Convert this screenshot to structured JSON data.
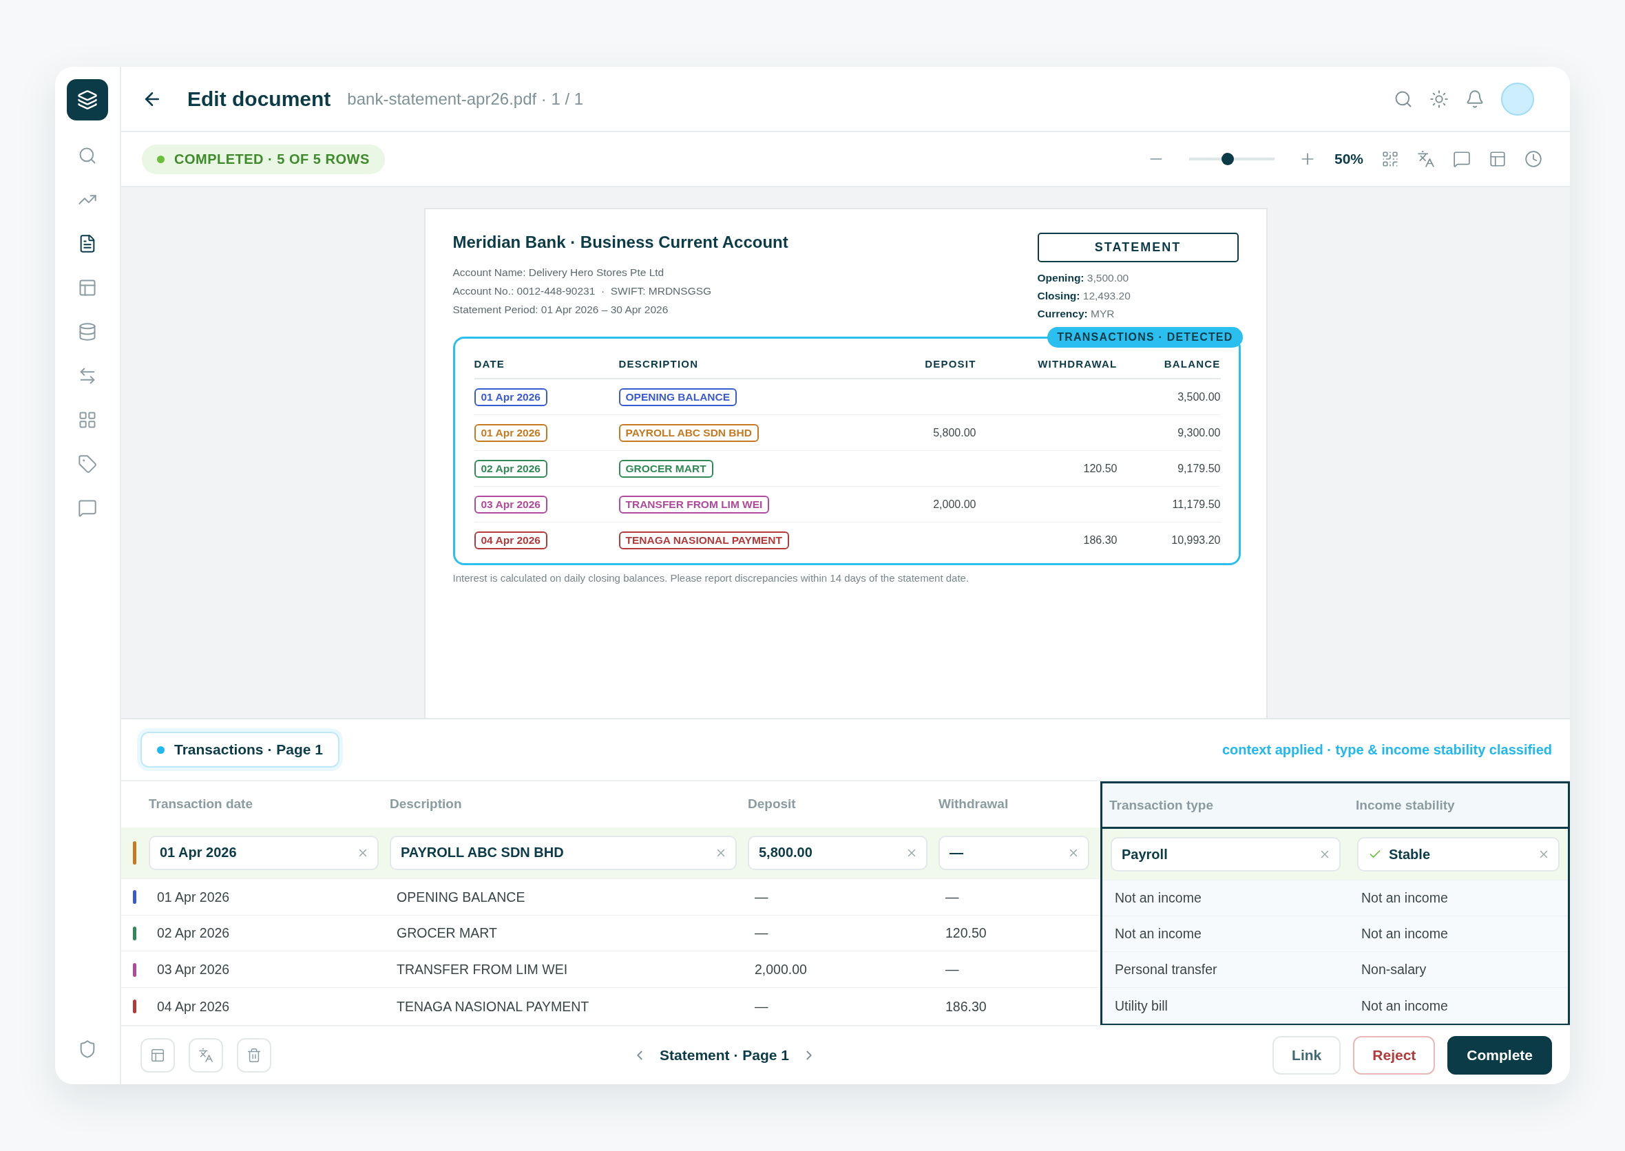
{
  "sidebar": {
    "items": [
      {
        "kind": "search",
        "selected": false
      },
      {
        "kind": "chart",
        "selected": false
      },
      {
        "kind": "document",
        "selected": true
      },
      {
        "kind": "layout",
        "selected": false
      },
      {
        "kind": "database",
        "selected": false
      },
      {
        "kind": "transfer",
        "selected": false
      },
      {
        "kind": "grid",
        "selected": false
      },
      {
        "kind": "tag",
        "selected": false
      },
      {
        "kind": "chat",
        "selected": false
      }
    ]
  },
  "header": {
    "title": "Edit document",
    "file": "bank-statement-apr26.pdf · 1 / 1"
  },
  "toolbar": {
    "status": "COMPLETED · 5 OF 5 ROWS",
    "zoom": {
      "level": 0.45,
      "reading": "50%"
    }
  },
  "document": {
    "title": "Meridian Bank · Business Current Account",
    "details": [
      "Account Name: Delivery Hero Stores Pte Ltd",
      "Account No.: 0012-448-90231  ·  SWIFT: MRDNSGSG",
      "Statement Period: 01 Apr 2026 – 30 Apr 2026"
    ],
    "label": "STATEMENT",
    "summary": [
      {
        "label": "Opening:",
        "value": "3,500.00"
      },
      {
        "label": "Closing:",
        "value": "12,493.20"
      },
      {
        "label": "Currency:",
        "value": "MYR"
      }
    ],
    "badge": "TRANSACTIONS · DETECTED",
    "columns": [
      "DATE",
      "DESCRIPTION",
      "DEPOSIT",
      "WITHDRAWAL",
      "BALANCE"
    ],
    "rows": [
      {
        "date": "01 Apr 2026",
        "description": "OPENING BALANCE",
        "deposit": "",
        "withdrawal": "",
        "balance": "3,500.00",
        "color": "#3a5bd0"
      },
      {
        "date": "01 Apr 2026",
        "description": "PAYROLL ABC SDN BHD",
        "deposit": "5,800.00",
        "withdrawal": "",
        "balance": "9,300.00",
        "color": "#c57a22"
      },
      {
        "date": "02 Apr 2026",
        "description": "GROCER MART",
        "deposit": "",
        "withdrawal": "120.50",
        "balance": "9,179.50",
        "color": "#2f8a55"
      },
      {
        "date": "03 Apr 2026",
        "description": "TRANSFER FROM LIM WEI",
        "deposit": "2,000.00",
        "withdrawal": "",
        "balance": "11,179.50",
        "color": "#b04a9d"
      },
      {
        "date": "04 Apr 2026",
        "description": "TENAGA NASIONAL PAYMENT",
        "deposit": "",
        "withdrawal": "186.30",
        "balance": "10,993.20",
        "color": "#b23a3a"
      }
    ],
    "footnote": "Interest is calculated on daily closing balances. Please report discrepancies within 14 days of the statement date."
  },
  "panel": {
    "tab": "Transactions · Page 1",
    "note": "context applied · type & income stability classified",
    "columns": [
      {
        "label": "Transaction date",
        "highlighted": false
      },
      {
        "label": "Description",
        "highlighted": false
      },
      {
        "label": "Deposit",
        "highlighted": false
      },
      {
        "label": "Withdrawal",
        "highlighted": false
      },
      {
        "label": "Transaction type",
        "highlighted": true
      },
      {
        "label": "Income stability",
        "highlighted": true
      }
    ],
    "rows": [
      {
        "color": "#c57a22",
        "selected": true,
        "cells": [
          "01 Apr 2026",
          "PAYROLL ABC SDN BHD",
          "5,800.00",
          "—",
          "Payroll",
          "Stable"
        ]
      },
      {
        "color": "#3a5bd0",
        "selected": false,
        "cells": [
          "01 Apr 2026",
          "OPENING BALANCE",
          "—",
          "—",
          "Not an income",
          "Not an income"
        ]
      },
      {
        "color": "#2f8a55",
        "selected": false,
        "cells": [
          "02 Apr 2026",
          "GROCER MART",
          "—",
          "120.50",
          "Not an income",
          "Not an income"
        ]
      },
      {
        "color": "#b04a9d",
        "selected": false,
        "cells": [
          "03 Apr 2026",
          "TRANSFER FROM LIM WEI",
          "2,000.00",
          "—",
          "Personal transfer",
          "Non-salary"
        ]
      },
      {
        "color": "#b23a3a",
        "selected": false,
        "cells": [
          "04 Apr 2026",
          "TENAGA NASIONAL PAYMENT",
          "—",
          "186.30",
          "Utility bill",
          "Not an income"
        ]
      }
    ],
    "pager": "Statement · Page 1",
    "buttons": [
      {
        "label": "Link",
        "kind": "plain"
      },
      {
        "label": "Reject",
        "kind": "danger"
      },
      {
        "label": "Complete",
        "kind": "primary"
      }
    ]
  }
}
